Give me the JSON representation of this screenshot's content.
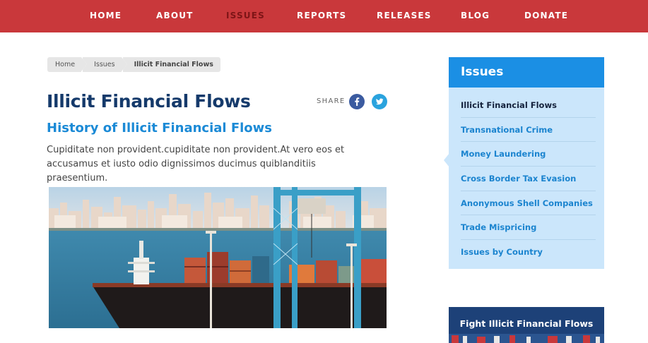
{
  "nav": {
    "items": [
      {
        "label": "HOME"
      },
      {
        "label": "ABOUT"
      },
      {
        "label": "ISSUES"
      },
      {
        "label": "REPORTS"
      },
      {
        "label": "RELEASES"
      },
      {
        "label": "BLOG"
      },
      {
        "label": "DONATE"
      }
    ],
    "active": "ISSUES"
  },
  "breadcrumb": [
    "Home",
    "Issues",
    "Illicit Financial Flows"
  ],
  "article": {
    "title": "Illicit Financial Flows",
    "subtitle": "History of Illicit Financial Flows",
    "intro": "Cupiditate non provident.cupiditate non provident.At vero eos et accusamus et iusto odio dignissimos ducimus quiblanditiis praesentium.",
    "share_label": "SHARE",
    "share_icons": [
      "facebook-icon",
      "twitter-icon"
    ],
    "hero_image": "container-ship-port-photo"
  },
  "sidebar": {
    "title": "Issues",
    "items": [
      "Illicit Financial Flows",
      "Transnational Crime",
      "Money Laundering",
      "Cross Border Tax Evasion",
      "Anonymous Shell Companies",
      "Trade Mispricing",
      "Issues by Country"
    ],
    "active": "Illicit Financial Flows"
  },
  "promo": {
    "label": "Fight Illicit Financial Flows"
  },
  "colors": {
    "nav_bg": "#c9383b",
    "nav_active": "#7d1416",
    "title": "#153a6b",
    "accent_blue": "#1b8ad6",
    "sidebar_bg": "#cbe6fb",
    "sidebar_head": "#1b8fe4"
  }
}
